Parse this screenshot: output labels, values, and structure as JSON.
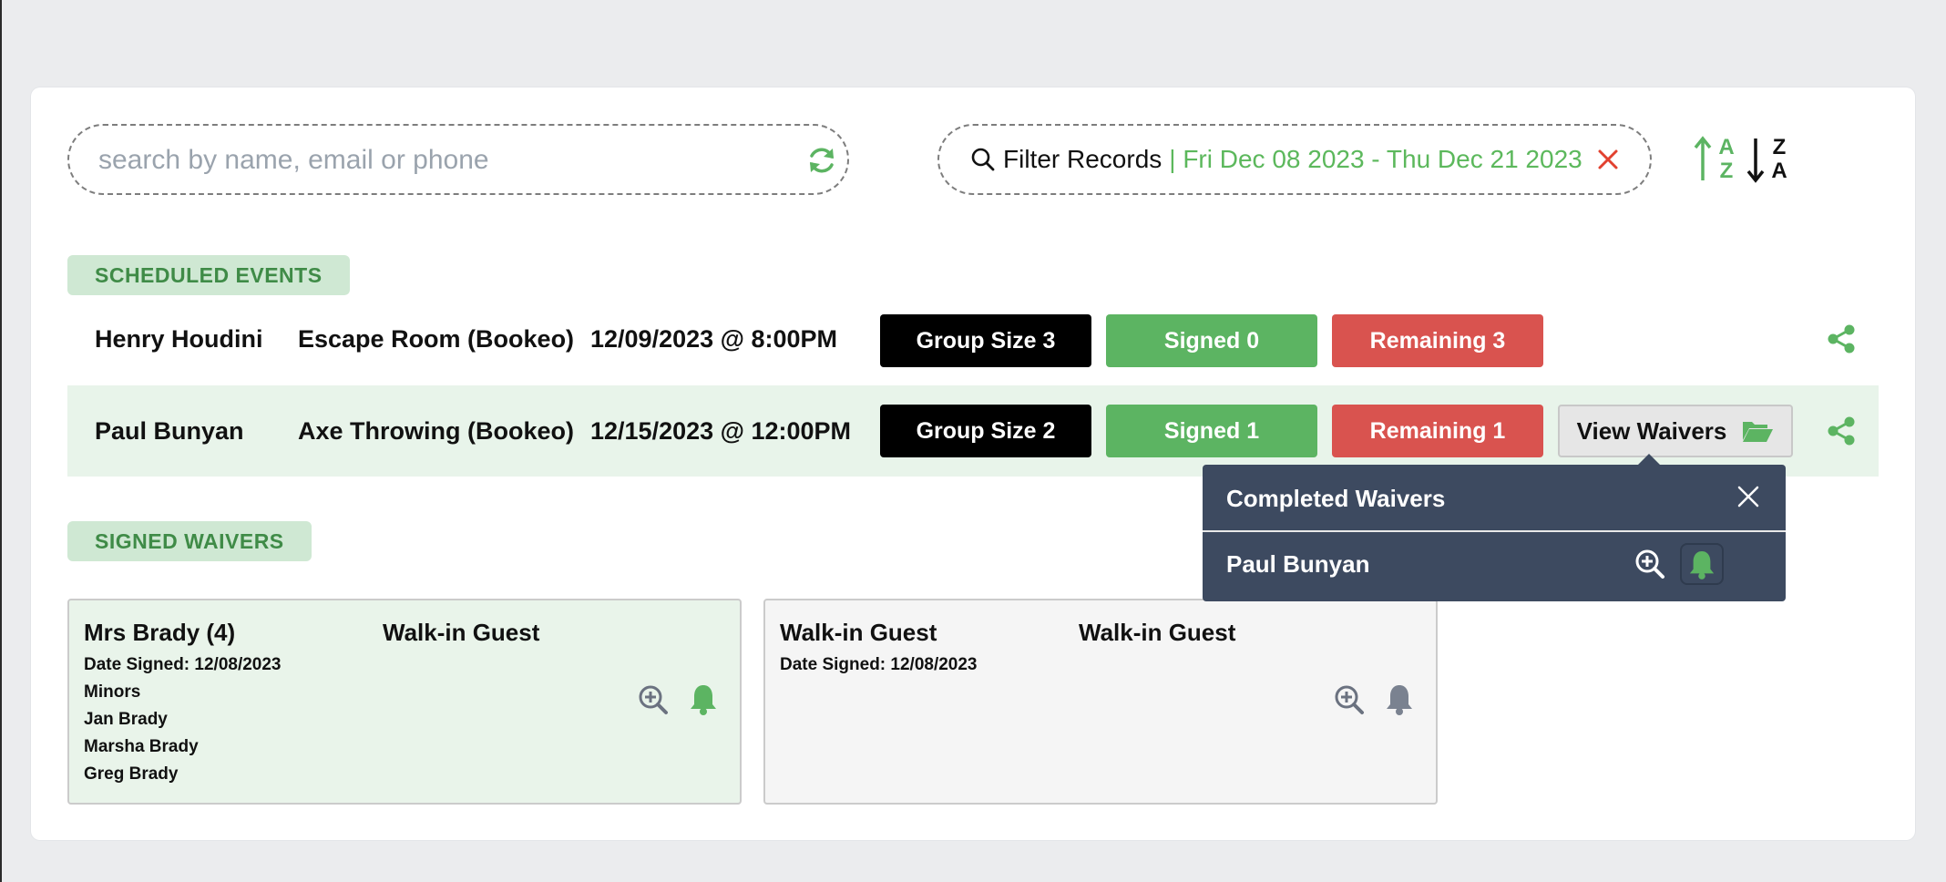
{
  "search": {
    "placeholder": "search by name, email or phone",
    "value": "",
    "refresh_icon": "refresh-icon"
  },
  "filter": {
    "label": "Filter Records",
    "range": "| Fri Dec 08 2023 - Thu Dec 21 2023",
    "icon": "search-icon",
    "clear_icon": "close-icon"
  },
  "sort": {
    "asc": {
      "top": "A",
      "bottom": "Z"
    },
    "desc": {
      "top": "Z",
      "bottom": "A"
    }
  },
  "sections": {
    "scheduled": "SCHEDULED EVENTS",
    "signed": "SIGNED WAIVERS"
  },
  "events": [
    {
      "name": "Henry Houdini",
      "activity": "Escape Room (Bookeo)",
      "datetime": "12/09/2023 @ 8:00PM",
      "group": "Group Size 3",
      "signed": "Signed 0",
      "remaining": "Remaining 3",
      "highlighted": false
    },
    {
      "name": "Paul Bunyan",
      "activity": "Axe Throwing (Bookeo)",
      "datetime": "12/15/2023 @ 12:00PM",
      "group": "Group Size 2",
      "signed": "Signed 1",
      "remaining": "Remaining 1",
      "view_waivers": "View Waivers",
      "highlighted": true
    }
  ],
  "popover": {
    "title": "Completed Waivers",
    "entries": [
      {
        "name": "Paul Bunyan"
      }
    ]
  },
  "waivers": [
    {
      "name": "Mrs Brady (4)",
      "guest_type": "Walk-in Guest",
      "date_signed": "Date Signed: 12/08/2023",
      "minors_label": "Minors",
      "minors": [
        "Jan Brady",
        "Marsha Brady",
        "Greg Brady"
      ],
      "bell_color": "#5cb462"
    },
    {
      "name": "Walk-in Guest",
      "guest_type": "Walk-in Guest",
      "date_signed": "Date Signed: 12/08/2023",
      "minors_label": "",
      "minors": [],
      "bell_color": "#7a8290"
    }
  ],
  "colors": {
    "accent_green": "#5cb462",
    "danger_red": "#d9534f",
    "popover_bg": "#3d4a60",
    "tag_bg": "#cfe8d3",
    "tag_text": "#3f8b47"
  }
}
